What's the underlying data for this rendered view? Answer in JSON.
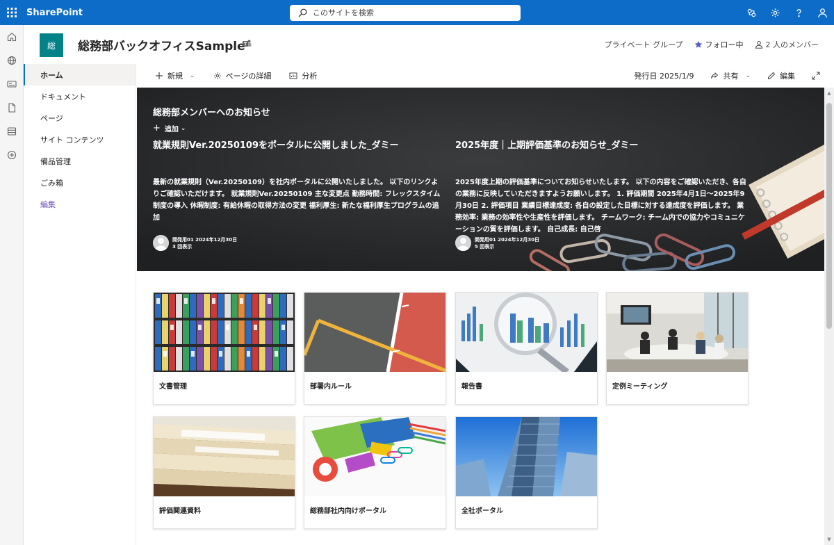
{
  "suite": {
    "brand": "SharePoint",
    "search_placeholder": "このサイトを検索"
  },
  "site": {
    "logo_text": "総",
    "title": "総務部バックオフィスSample",
    "privacy": "プライベート グループ",
    "follow": "フォロー中",
    "members": "2 人のメンバー",
    "colors": {
      "suite": "#0c6cc7",
      "logo": "#038387",
      "nav_edit": "#6b4fbb"
    }
  },
  "nav": {
    "items": [
      {
        "label": "ホーム"
      },
      {
        "label": "ドキュメント"
      },
      {
        "label": "ページ"
      },
      {
        "label": "サイト コンテンツ"
      },
      {
        "label": "備品管理"
      },
      {
        "label": "ごみ箱"
      }
    ],
    "edit": "編集"
  },
  "commandbar": {
    "new": "新規",
    "page_details": "ページの詳細",
    "analytics": "分析",
    "published": "発行日 2025/1/9",
    "share": "共有",
    "edit": "編集"
  },
  "hero": {
    "title": "総務部メンバーへのお知らせ",
    "add": "追加",
    "news": [
      {
        "headline": "就業規則Ver.20250109をポータルに公開しました_ダミー",
        "body": "最新の就業規則（Ver.20250109）を社内ポータルに公開いたしました。 以下のリンクよりご確認いただけます。 就業規則Ver.20250109 主な変更点 勤務時間: フレックスタイム制度の導入 休暇制度: 有給休暇の取得方法の変更 福利厚生: 新たな福利厚生プログラムの追加",
        "author": "開発用01 2024年12月30日",
        "views": "3 回表示"
      },
      {
        "headline": "2025年度｜上期評価基準のお知らせ_ダミー",
        "body": "2025年度上期の評価基準についてお知らせいたします。 以下の内容をご確認いただき、各自の業務に反映していただきますようお願いします。 1. 評価期間 2025年4月1日～2025年9月30日 2. 評価項目 業績目標達成度: 各自の設定した目標に対する達成度を評価します。 業務効率: 業務の効率性や生産性を評価します。 チームワーク: チーム内での協力やコミュニケーションの質を評価します。 自己成長: 自己啓",
        "author": "開発用01 2024年12月30日",
        "views": "5 回表示"
      }
    ]
  },
  "quicklinks": [
    {
      "label": "文書管理",
      "image": "binders"
    },
    {
      "label": "部署内ルール",
      "image": "court-lines"
    },
    {
      "label": "報告書",
      "image": "chart-magnifier"
    },
    {
      "label": "定例ミーティング",
      "image": "meeting-room"
    },
    {
      "label": "評価関連資料",
      "image": "folders"
    },
    {
      "label": "総務部社内向けポータル",
      "image": "stationery"
    },
    {
      "label": "全社ポータル",
      "image": "skyscraper"
    }
  ]
}
